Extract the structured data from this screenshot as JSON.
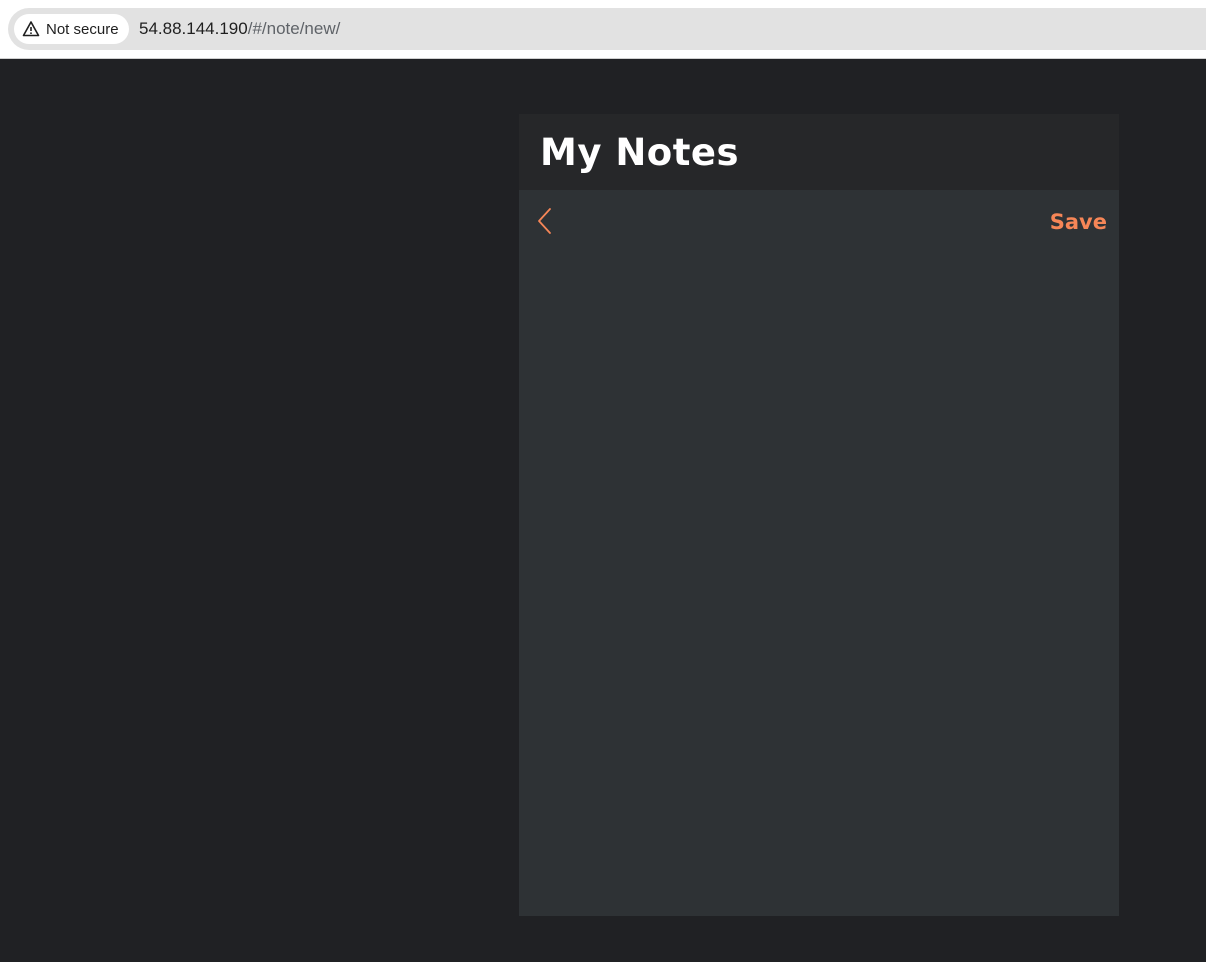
{
  "browser": {
    "security_label": "Not secure",
    "url_host": "54.88.144.190",
    "url_path": "/#/note/new/"
  },
  "app": {
    "title": "My Notes",
    "save_label": "Save",
    "back_icon": "chevron-left-icon",
    "note_body": ""
  },
  "colors": {
    "accent": "#f68657",
    "page_background": "#202124",
    "header_background": "#262729",
    "panel_background": "#2e3235"
  }
}
